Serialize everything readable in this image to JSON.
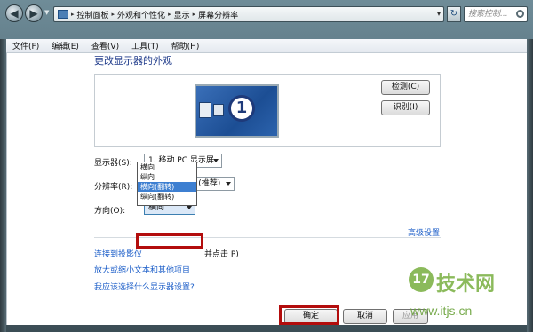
{
  "window": {
    "nav_back_glyph": "◀",
    "nav_forward_glyph": "▶",
    "refresh_glyph": "↻",
    "address": {
      "segments": [
        "控制面板",
        "外观和个性化",
        "显示",
        "屏幕分辨率"
      ],
      "separator": "▸"
    },
    "search": {
      "placeholder": "搜索控制..."
    }
  },
  "menubar": {
    "items": [
      "文件(F)",
      "编辑(E)",
      "查看(V)",
      "工具(T)",
      "帮助(H)"
    ]
  },
  "page": {
    "heading": "更改显示器的外观",
    "monitor_number": "1",
    "detect_button": "检测(C)",
    "identify_button": "识别(I)",
    "display_label": "显示器(S):",
    "display_value": "1. 移动 PC 显示屏",
    "resolution_label": "分辨率(R):",
    "resolution_value": "1366 × 768 (推荐)",
    "orientation_label": "方向(O):",
    "orientation_value": "横向",
    "orientation_options": [
      "横向",
      "纵向",
      "横向(翻转)",
      "纵向(翻转)"
    ],
    "orientation_highlighted_index": 2,
    "advanced_link": "高级设置",
    "link_projector": "连接到投影仪",
    "link_projector_tail": "并点击 P)",
    "link_text_size": "放大或缩小文本和其他项目",
    "link_which_settings": "我应该选择什么显示器设置?",
    "ok_button": "确定",
    "cancel_button": "取消",
    "apply_button": "应用"
  },
  "watermark": {
    "logo_text": "17",
    "title": "技术网",
    "url": "www.itjs.cn"
  },
  "colors": {
    "link": "#1c5ec8",
    "heading": "#1e3a8a",
    "annotation_red": "#b30d0d",
    "selection_blue": "#3d7fd1",
    "watermark_green": "#7fb34a"
  }
}
